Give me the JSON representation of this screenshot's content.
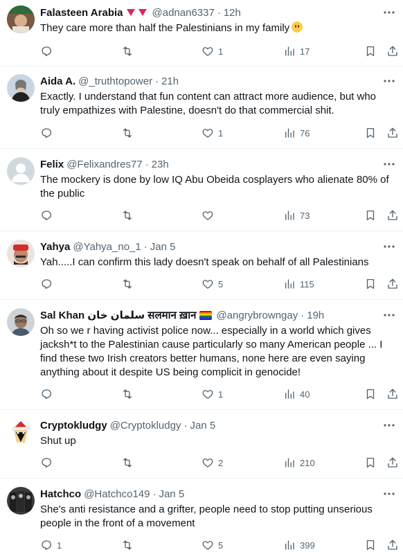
{
  "tweets": [
    {
      "name": "Falasteen Arabia",
      "handle": "@adnan6337",
      "time": "12h",
      "text": "They care more than half the Palestinians in my family",
      "replies": "",
      "likes": "1",
      "views": "17",
      "avatar_color": "#6b4a3a"
    },
    {
      "name": "Aida A.",
      "handle": "@_truthtopower",
      "time": "21h",
      "text": "Exactly. I understand that fun content can attract more audience, but who truly empathizes with Palestine, doesn't do that commercial shit.",
      "replies": "",
      "likes": "1",
      "views": "76",
      "avatar_color": "#c9d6e2"
    },
    {
      "name": "Felix",
      "handle": "@Felixandres77",
      "time": "23h",
      "text": "The mockery is done by low IQ Abu Obeida cosplayers who alienate 80% of the public",
      "replies": "",
      "likes": "",
      "views": "73",
      "avatar_color": "#cfd9de"
    },
    {
      "name": "Yahya",
      "handle": "@Yahya_no_1",
      "time": "Jan 5",
      "text": "Yah.....I can confirm this lady doesn't speak on behalf of all Palestinians",
      "replies": "",
      "likes": "5",
      "views": "115",
      "avatar_color": "#b98a6e"
    },
    {
      "name": "Sal Khan سلمان خان सलमान ख़ान",
      "handle": "@angrybrowngay",
      "time": "19h",
      "text": "Oh so we r having activist police now... especially in a world which gives jacksh*t to the Palestinian cause particularly so many American people ... I find these two Irish creators better humans, none here are even saying anything about it despite US being complicit in genocide!",
      "replies": "",
      "likes": "1",
      "views": "40",
      "avatar_color": "#9b7b63"
    },
    {
      "name": "Cryptokludgy",
      "handle": "@Cryptokludgy",
      "time": "Jan 5",
      "text": "Shut up",
      "replies": "",
      "likes": "2",
      "views": "210",
      "avatar_color": "#f5f5f5"
    },
    {
      "name": "Hatchco",
      "handle": "@Hatchco149",
      "time": "Jan 5",
      "text": "She's anti resistance and a grifter, people need to stop putting unserious people in the front of a movement",
      "replies": "1",
      "likes": "5",
      "views": "399",
      "avatar_color": "#3a3a3a"
    }
  ],
  "icons": {
    "reply": "reply-icon",
    "retweet": "retweet-icon",
    "like": "heart-icon",
    "views": "views-icon",
    "bookmark": "bookmark-icon",
    "share": "share-icon",
    "more": "more-icon"
  },
  "colors": {
    "text": "#0f1419",
    "muted": "#536471",
    "divider": "#eff3f4"
  }
}
